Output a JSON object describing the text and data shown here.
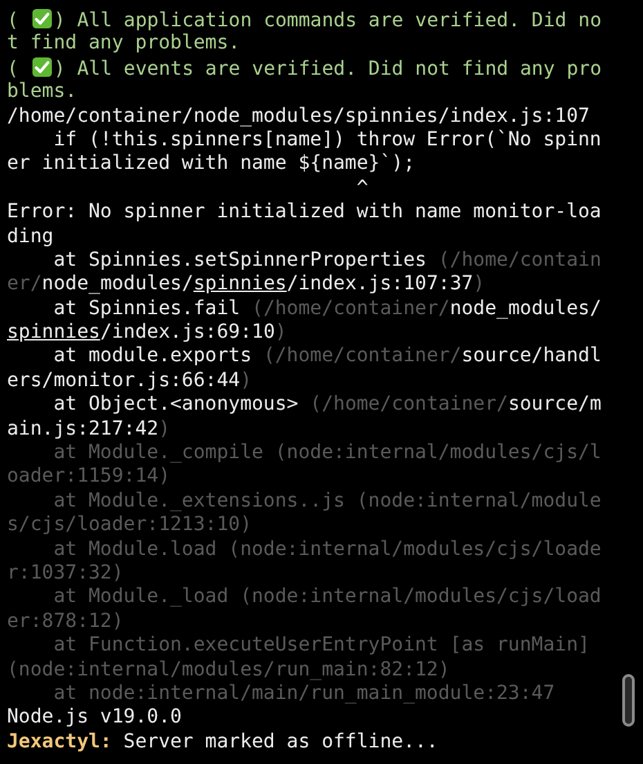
{
  "terminal": {
    "lines": [
      [
        {
          "kind": "green",
          "text": "( "
        },
        {
          "kind": "check"
        },
        {
          "kind": "green",
          "text": ") All application commands are verified. Did no"
        }
      ],
      [
        {
          "kind": "green",
          "text": "t find any problems."
        }
      ],
      [
        {
          "kind": "green",
          "text": "( "
        },
        {
          "kind": "check"
        },
        {
          "kind": "green",
          "text": ") All events are verified. Did not find any pro"
        }
      ],
      [
        {
          "kind": "green",
          "text": "blems."
        }
      ],
      [
        {
          "kind": "plain",
          "text": "/home/container/node_modules/spinnies/index.js:107"
        }
      ],
      [
        {
          "kind": "plain",
          "text": "    if (!this.spinners[name]) throw Error(`No spinn"
        }
      ],
      [
        {
          "kind": "plain",
          "text": "er initialized with name ${name}`);"
        }
      ],
      [
        {
          "kind": "plain",
          "text": "                              ^"
        }
      ],
      [
        {
          "kind": "plain",
          "text": "Error: No spinner initialized with name monitor-loa"
        }
      ],
      [
        {
          "kind": "plain",
          "text": "ding"
        }
      ],
      [
        {
          "kind": "plain",
          "text": "    at Spinnies.setSpinnerProperties "
        },
        {
          "kind": "dim",
          "text": "(/home/contain"
        }
      ],
      [
        {
          "kind": "dim",
          "text": "er/"
        },
        {
          "kind": "plain",
          "text": "node_modules/"
        },
        {
          "kind": "underline",
          "text": "spinnies"
        },
        {
          "kind": "plain",
          "text": "/index.js:107:37"
        },
        {
          "kind": "dim",
          "text": ")"
        }
      ],
      [
        {
          "kind": "plain",
          "text": "    at Spinnies.fail "
        },
        {
          "kind": "dim",
          "text": "(/home/container/"
        },
        {
          "kind": "plain",
          "text": "node_modules/"
        }
      ],
      [
        {
          "kind": "underline",
          "text": "spinnies"
        },
        {
          "kind": "plain",
          "text": "/index.js:69:10"
        },
        {
          "kind": "dim",
          "text": ")"
        }
      ],
      [
        {
          "kind": "plain",
          "text": "    at module.exports "
        },
        {
          "kind": "dim",
          "text": "(/home/container/"
        },
        {
          "kind": "plain",
          "text": "source/handl"
        }
      ],
      [
        {
          "kind": "plain",
          "text": "ers/monitor.js:66:44"
        },
        {
          "kind": "dim",
          "text": ")"
        }
      ],
      [
        {
          "kind": "plain",
          "text": "    at Object.<anonymous> "
        },
        {
          "kind": "dim",
          "text": "(/home/container/"
        },
        {
          "kind": "plain",
          "text": "source/m"
        }
      ],
      [
        {
          "kind": "plain",
          "text": "ain.js:217:42"
        },
        {
          "kind": "dim",
          "text": ")"
        }
      ],
      [
        {
          "kind": "dim",
          "text": "    at Module._compile (node:internal/modules/cjs/l"
        }
      ],
      [
        {
          "kind": "dim",
          "text": "oader:1159:14)"
        }
      ],
      [
        {
          "kind": "dim",
          "text": "    at Module._extensions..js (node:internal/module"
        }
      ],
      [
        {
          "kind": "dim",
          "text": "s/cjs/loader:1213:10)"
        }
      ],
      [
        {
          "kind": "dim",
          "text": "    at Module.load (node:internal/modules/cjs/loade"
        }
      ],
      [
        {
          "kind": "dim",
          "text": "r:1037:32)"
        }
      ],
      [
        {
          "kind": "dim",
          "text": "    at Module._load (node:internal/modules/cjs/load"
        }
      ],
      [
        {
          "kind": "dim",
          "text": "er:878:12)"
        }
      ],
      [
        {
          "kind": "dim",
          "text": "    at Function.executeUserEntryPoint [as runMain]"
        }
      ],
      [
        {
          "kind": "dim",
          "text": "(node:internal/modules/run_main:82:12)"
        }
      ],
      [
        {
          "kind": "dim",
          "text": "    at node:internal/main/run_main_module:23:47"
        }
      ],
      [
        {
          "kind": "plain",
          "text": "Node.js v19.0.0"
        }
      ],
      [
        {
          "kind": "yellow",
          "text": "Jexactyl:"
        },
        {
          "kind": "plain",
          "text": " Server marked as offline..."
        }
      ]
    ]
  }
}
